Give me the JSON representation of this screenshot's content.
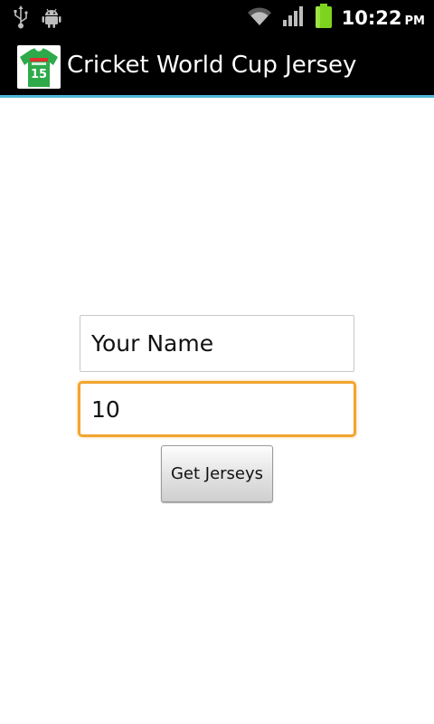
{
  "status_bar": {
    "time": "10:22",
    "ampm": "PM",
    "icons": [
      "usb-icon",
      "android-debug-icon",
      "wifi-icon",
      "signal-icon",
      "battery-icon"
    ],
    "battery_color": "#7ed321"
  },
  "app": {
    "title": "Cricket World Cup Jersey",
    "icon_number": "15"
  },
  "form": {
    "name_placeholder": "Your Name",
    "number_value": "10",
    "submit_label": "Get Jerseys"
  },
  "colors": {
    "accent_line": "#4fb6d8",
    "focus_border": "#f2a530",
    "jersey_green": "#2eaa4a"
  }
}
